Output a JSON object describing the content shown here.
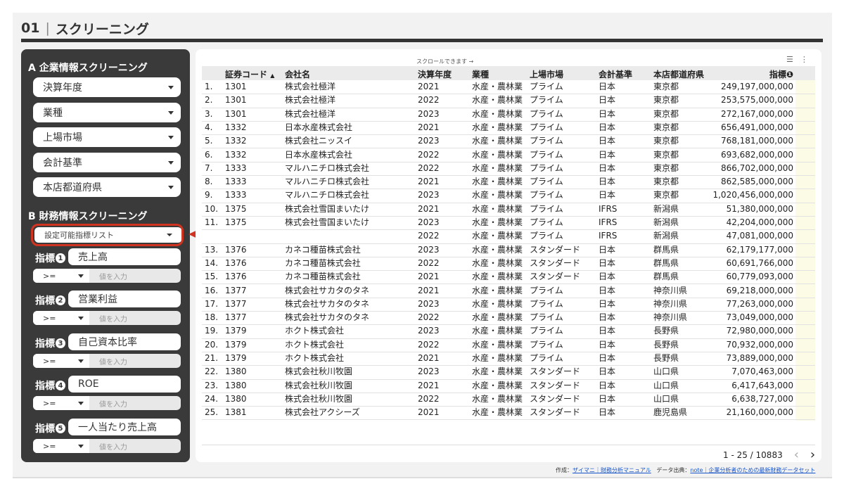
{
  "header": {
    "number": "01",
    "title": "スクリーニング"
  },
  "sidebar": {
    "section_a": "A 企業情報スクリーニング",
    "filters": [
      "決算年度",
      "業種",
      "上場市場",
      "会計基準",
      "本店都道府県"
    ],
    "section_b": "B 財務情報スクリーニング",
    "metric_list": "設定可能指標リスト",
    "metric_prefix": "指標",
    "metrics": [
      {
        "num": "1",
        "name": "売上高",
        "operator": ">=",
        "placeholder": "値を入力"
      },
      {
        "num": "2",
        "name": "営業利益",
        "operator": ">=",
        "placeholder": "値を入力"
      },
      {
        "num": "3",
        "name": "自己資本比率",
        "operator": ">=",
        "placeholder": "値を入力"
      },
      {
        "num": "4",
        "name": "ROE",
        "operator": ">=",
        "placeholder": "値を入力"
      },
      {
        "num": "5",
        "name": "一人当たり売上高",
        "operator": ">=",
        "placeholder": "値を入力"
      }
    ]
  },
  "table": {
    "scroll_note": "スクロールできます →",
    "columns": [
      "証券コード",
      "会社名",
      "決算年度",
      "業種",
      "上場市場",
      "会計基準",
      "本店都道府県",
      "指標❶"
    ],
    "sort_indicator": "▲",
    "rows": [
      [
        "1.",
        "1301",
        "株式会社極洋",
        "2021",
        "水産・農林業",
        "プライム",
        "日本",
        "東京都",
        "249,197,000,000"
      ],
      [
        "2.",
        "1301",
        "株式会社極洋",
        "2022",
        "水産・農林業",
        "プライム",
        "日本",
        "東京都",
        "253,575,000,000"
      ],
      [
        "3.",
        "1301",
        "株式会社極洋",
        "2023",
        "水産・農林業",
        "プライム",
        "日本",
        "東京都",
        "272,167,000,000"
      ],
      [
        "4.",
        "1332",
        "日本水産株式会社",
        "2021",
        "水産・農林業",
        "プライム",
        "日本",
        "東京都",
        "656,491,000,000"
      ],
      [
        "5.",
        "1332",
        "株式会社ニッスイ",
        "2023",
        "水産・農林業",
        "プライム",
        "日本",
        "東京都",
        "768,181,000,000"
      ],
      [
        "6.",
        "1332",
        "日本水産株式会社",
        "2022",
        "水産・農林業",
        "プライム",
        "日本",
        "東京都",
        "693,682,000,000"
      ],
      [
        "7.",
        "1333",
        "マルハニチロ株式会社",
        "2022",
        "水産・農林業",
        "プライム",
        "日本",
        "東京都",
        "866,702,000,000"
      ],
      [
        "8.",
        "1333",
        "マルハニチロ株式会社",
        "2021",
        "水産・農林業",
        "プライム",
        "日本",
        "東京都",
        "862,585,000,000"
      ],
      [
        "9.",
        "1333",
        "マルハニチロ株式会社",
        "2023",
        "水産・農林業",
        "プライム",
        "日本",
        "東京都",
        "1,020,456,000,000"
      ],
      [
        "10.",
        "1375",
        "株式会社雪国まいたけ",
        "2021",
        "水産・農林業",
        "プライム",
        "IFRS",
        "新潟県",
        "51,380,000,000"
      ],
      [
        "11.",
        "1375",
        "株式会社雪国まいたけ",
        "2023",
        "水産・農林業",
        "プライム",
        "IFRS",
        "新潟県",
        "42,204,000,000"
      ],
      [
        "",
        "",
        "",
        "2022",
        "水産・農林業",
        "プライム",
        "IFRS",
        "新潟県",
        "47,081,000,000"
      ],
      [
        "13.",
        "1376",
        "カネコ種苗株式会社",
        "2023",
        "水産・農林業",
        "スタンダード",
        "日本",
        "群馬県",
        "62,179,177,000"
      ],
      [
        "14.",
        "1376",
        "カネコ種苗株式会社",
        "2022",
        "水産・農林業",
        "スタンダード",
        "日本",
        "群馬県",
        "60,691,766,000"
      ],
      [
        "15.",
        "1376",
        "カネコ種苗株式会社",
        "2021",
        "水産・農林業",
        "スタンダード",
        "日本",
        "群馬県",
        "60,779,093,000"
      ],
      [
        "16.",
        "1377",
        "株式会社サカタのタネ",
        "2021",
        "水産・農林業",
        "プライム",
        "日本",
        "神奈川県",
        "69,218,000,000"
      ],
      [
        "17.",
        "1377",
        "株式会社サカタのタネ",
        "2023",
        "水産・農林業",
        "プライム",
        "日本",
        "神奈川県",
        "77,263,000,000"
      ],
      [
        "18.",
        "1377",
        "株式会社サカタのタネ",
        "2022",
        "水産・農林業",
        "プライム",
        "日本",
        "神奈川県",
        "73,049,000,000"
      ],
      [
        "19.",
        "1379",
        "ホクト株式会社",
        "2023",
        "水産・農林業",
        "プライム",
        "日本",
        "長野県",
        "72,980,000,000"
      ],
      [
        "20.",
        "1379",
        "ホクト株式会社",
        "2022",
        "水産・農林業",
        "プライム",
        "日本",
        "長野県",
        "70,932,000,000"
      ],
      [
        "21.",
        "1379",
        "ホクト株式会社",
        "2021",
        "水産・農林業",
        "プライム",
        "日本",
        "長野県",
        "73,889,000,000"
      ],
      [
        "22.",
        "1380",
        "株式会社秋川牧園",
        "2023",
        "水産・農林業",
        "スタンダード",
        "日本",
        "山口県",
        "7,070,463,000"
      ],
      [
        "23.",
        "1380",
        "株式会社秋川牧園",
        "2021",
        "水産・農林業",
        "スタンダード",
        "日本",
        "山口県",
        "6,417,643,000"
      ],
      [
        "24.",
        "1380",
        "株式会社秋川牧園",
        "2022",
        "水産・農林業",
        "スタンダード",
        "日本",
        "山口県",
        "6,638,727,000"
      ],
      [
        "25.",
        "1381",
        "株式会社アクシーズ",
        "2021",
        "水産・農林業",
        "スタンダード",
        "日本",
        "鹿児島県",
        "21,160,000,000"
      ]
    ],
    "pager": "1 - 25 / 10883"
  },
  "credit": {
    "made_by": "作成：",
    "made_by_link": "ザイマニ｜財務分析マニュアル",
    "source": "データ出典：",
    "source_link": "note｜企業分析者のための最新財務データセット"
  },
  "colors": {
    "sidebar_bg": "#3a3a3a",
    "highlight": "#d0331f",
    "link": "#1a56c8"
  }
}
